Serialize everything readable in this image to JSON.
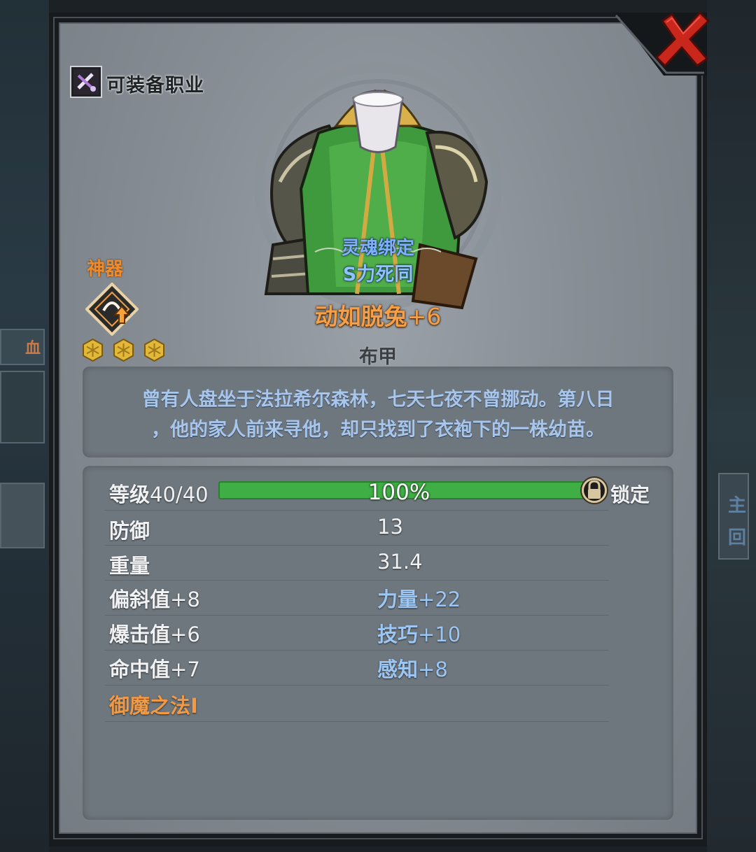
{
  "header": {
    "equip_job_label": "可装备职业"
  },
  "item": {
    "rarity_label": "神器",
    "stars": 3,
    "soul_bound_label": "灵魂绑定",
    "bound_to": "S力死同",
    "name": "动如脱兔",
    "enhance": "+6",
    "type": "布甲",
    "description_line1": "曾有人盘坐于法拉希尔森林，七天七夜不曾挪动。第八日",
    "description_line2": "，他的家人前来寻他，却只找到了衣袍下的一株幼苗。"
  },
  "stats": {
    "level_label": "等级",
    "level_value": "40/40",
    "level_progress": 1.0,
    "level_percent_text": "100%",
    "lock_label": "锁定",
    "defense_label": "防御",
    "defense_value": "13",
    "weight_label": "重量",
    "weight_value": "31.4",
    "deflect_label": "偏斜值",
    "deflect_value": "+8",
    "strength_label": "力量",
    "strength_value": "+22",
    "crit_label": "爆击值",
    "crit_value": "+6",
    "skill_label": "技巧",
    "skill_value": "+10",
    "hit_label": "命中值",
    "hit_value": "+7",
    "perception_label": "感知",
    "perception_value": "+8",
    "special_skill": "御魔之法I"
  },
  "background": {
    "left_char": "血",
    "right_chars": [
      "主",
      "回"
    ]
  },
  "colors": {
    "item_name": "#f5a048",
    "rarity": "#f08a2a",
    "bound": "#8fc2ff",
    "description": "#a8c6ec",
    "secondary_stat": "#9cc6f4",
    "special_skill": "#f09a46",
    "level_bar": "#3fae45",
    "close": "#d42a20"
  }
}
